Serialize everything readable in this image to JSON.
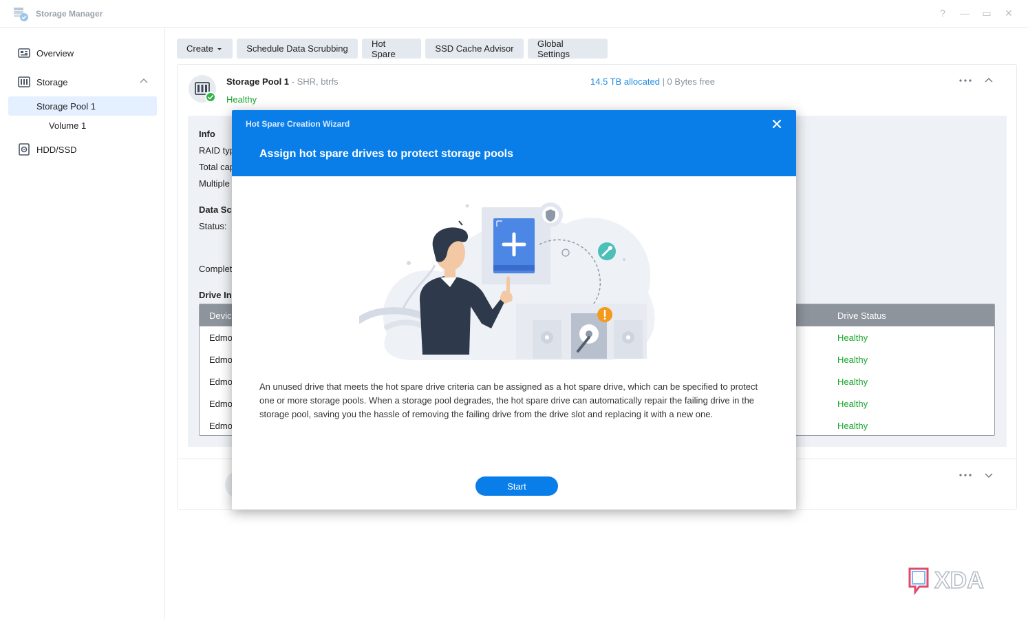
{
  "window": {
    "title": "Storage Manager",
    "controls": [
      "?",
      "—",
      "▭",
      "✕"
    ]
  },
  "sidebar": {
    "items": [
      {
        "label": "Overview",
        "icon": "overview-icon"
      },
      {
        "label": "Storage",
        "icon": "storage-icon"
      },
      {
        "label": "Storage Pool 1"
      },
      {
        "label": "Volume 1"
      },
      {
        "label": "HDD/SSD",
        "icon": "hdd-icon"
      }
    ]
  },
  "toolbar": {
    "create": "Create",
    "scrub": "Schedule Data Scrubbing",
    "hot_spare": "Hot Spare",
    "ssd_cache": "SSD Cache Advisor",
    "global_settings": "Global Settings"
  },
  "pool": {
    "name": "Storage Pool 1",
    "subtitle": "- SHR, btrfs",
    "status": "Healthy",
    "allocated": "14.5 TB allocated",
    "free": " | 0 Bytes free",
    "info": {
      "heading": "Info",
      "raid": "RAID typ",
      "total": "Total cap",
      "multiple": "Multiple",
      "scrub_heading": "Data Sc",
      "status": "Status:",
      "completed": "Complet",
      "drive_heading": "Drive In"
    },
    "drive_table": {
      "col_device": "Devic",
      "col_status": "Drive Status",
      "rows": [
        {
          "device": "Edmo",
          "status": "Healthy"
        },
        {
          "device": "Edmo",
          "status": "Healthy"
        },
        {
          "device": "Edmo",
          "status": "Healthy"
        },
        {
          "device": "Edmo",
          "status": "Healthy"
        },
        {
          "device": "Edmo",
          "status": "Healthy"
        }
      ]
    }
  },
  "dialog": {
    "window_title": "Hot Spare Creation Wizard",
    "heading": "Assign hot spare drives to protect storage pools",
    "description": "An unused drive that meets the hot spare drive criteria can be assigned as a hot spare drive, which can be specified to protect one or more storage pools. When a storage pool degrades, the hot spare drive can automatically repair the failing drive in the storage pool, saving you the hassle of removing the failing drive from the drive slot and replacing it with a new one.",
    "start": "Start"
  },
  "watermark": {
    "text": "XDA"
  },
  "colors": {
    "accent": "#0a7ee8",
    "healthy": "#1aa52e",
    "link": "#1b8ae0",
    "selected_bg": "#e4efff"
  }
}
